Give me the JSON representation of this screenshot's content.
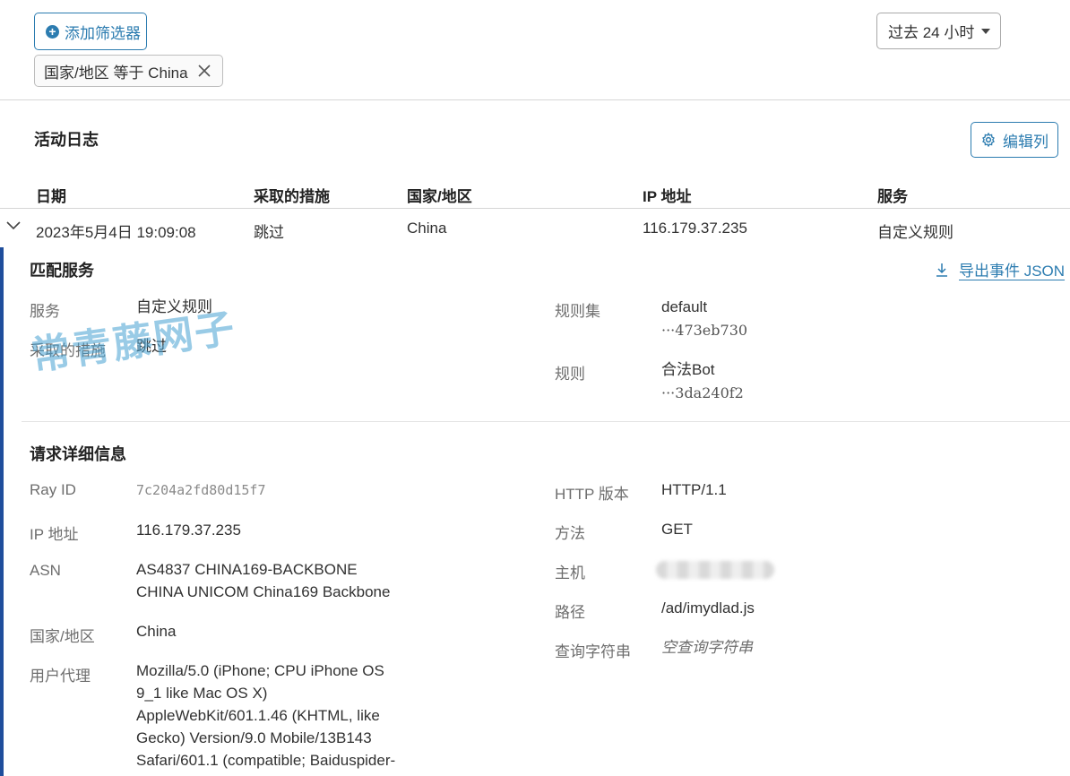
{
  "toolbar": {
    "add_filter_label": "添加筛选器",
    "filter_chip_label": "国家/地区 等于 China",
    "time_range": "过去 24 小时"
  },
  "activity_log": {
    "title": "活动日志",
    "edit_columns_label": "编辑列",
    "columns": [
      "日期",
      "采取的措施",
      "国家/地区",
      "IP 地址",
      "服务"
    ],
    "row": {
      "date": "2023年5月4日 19:09:08",
      "action": "跳过",
      "country": "China",
      "ip": "116.179.37.235",
      "service": "自定义规则"
    }
  },
  "matched_service": {
    "title": "匹配服务",
    "export_label": "导出事件 JSON",
    "service_label": "服务",
    "service_value": "自定义规则",
    "action_label": "采取的措施",
    "action_value": "跳过",
    "ruleset_label": "规则集",
    "ruleset_name": "default",
    "ruleset_id": "···473eb730",
    "rule_label": "规则",
    "rule_name": "合法Bot",
    "rule_id": "···3da240f2"
  },
  "request_details": {
    "title": "请求详细信息",
    "ray_id_label": "Ray ID",
    "ray_id_value": "7c204a2fd80d15f7",
    "ip_label": "IP 地址",
    "ip_value": "116.179.37.235",
    "asn_label": "ASN",
    "asn_line1": "AS4837 CHINA169-BACKBONE",
    "asn_line2": "CHINA UNICOM China169 Backbone",
    "country_label": "国家/地区",
    "country_value": "China",
    "ua_label": "用户代理",
    "ua_lines": [
      "Mozilla/5.0 (iPhone; CPU iPhone OS",
      "9_1 like Mac OS X)",
      "AppleWebKit/601.1.46 (KHTML, like",
      "Gecko) Version/9.0 Mobile/13B143",
      "Safari/601.1 (compatible; Baiduspider-"
    ],
    "http_version_label": "HTTP 版本",
    "http_version_value": "HTTP/1.1",
    "method_label": "方法",
    "method_value": "GET",
    "host_label": "主机",
    "path_label": "路径",
    "path_value": "/ad/imydlad.js",
    "query_label": "查询字符串",
    "query_value": "空查询字符串"
  },
  "watermark": "常青藤网子",
  "colors": {
    "accent": "#2c7cb0",
    "left_bar": "#1f4e9c"
  }
}
